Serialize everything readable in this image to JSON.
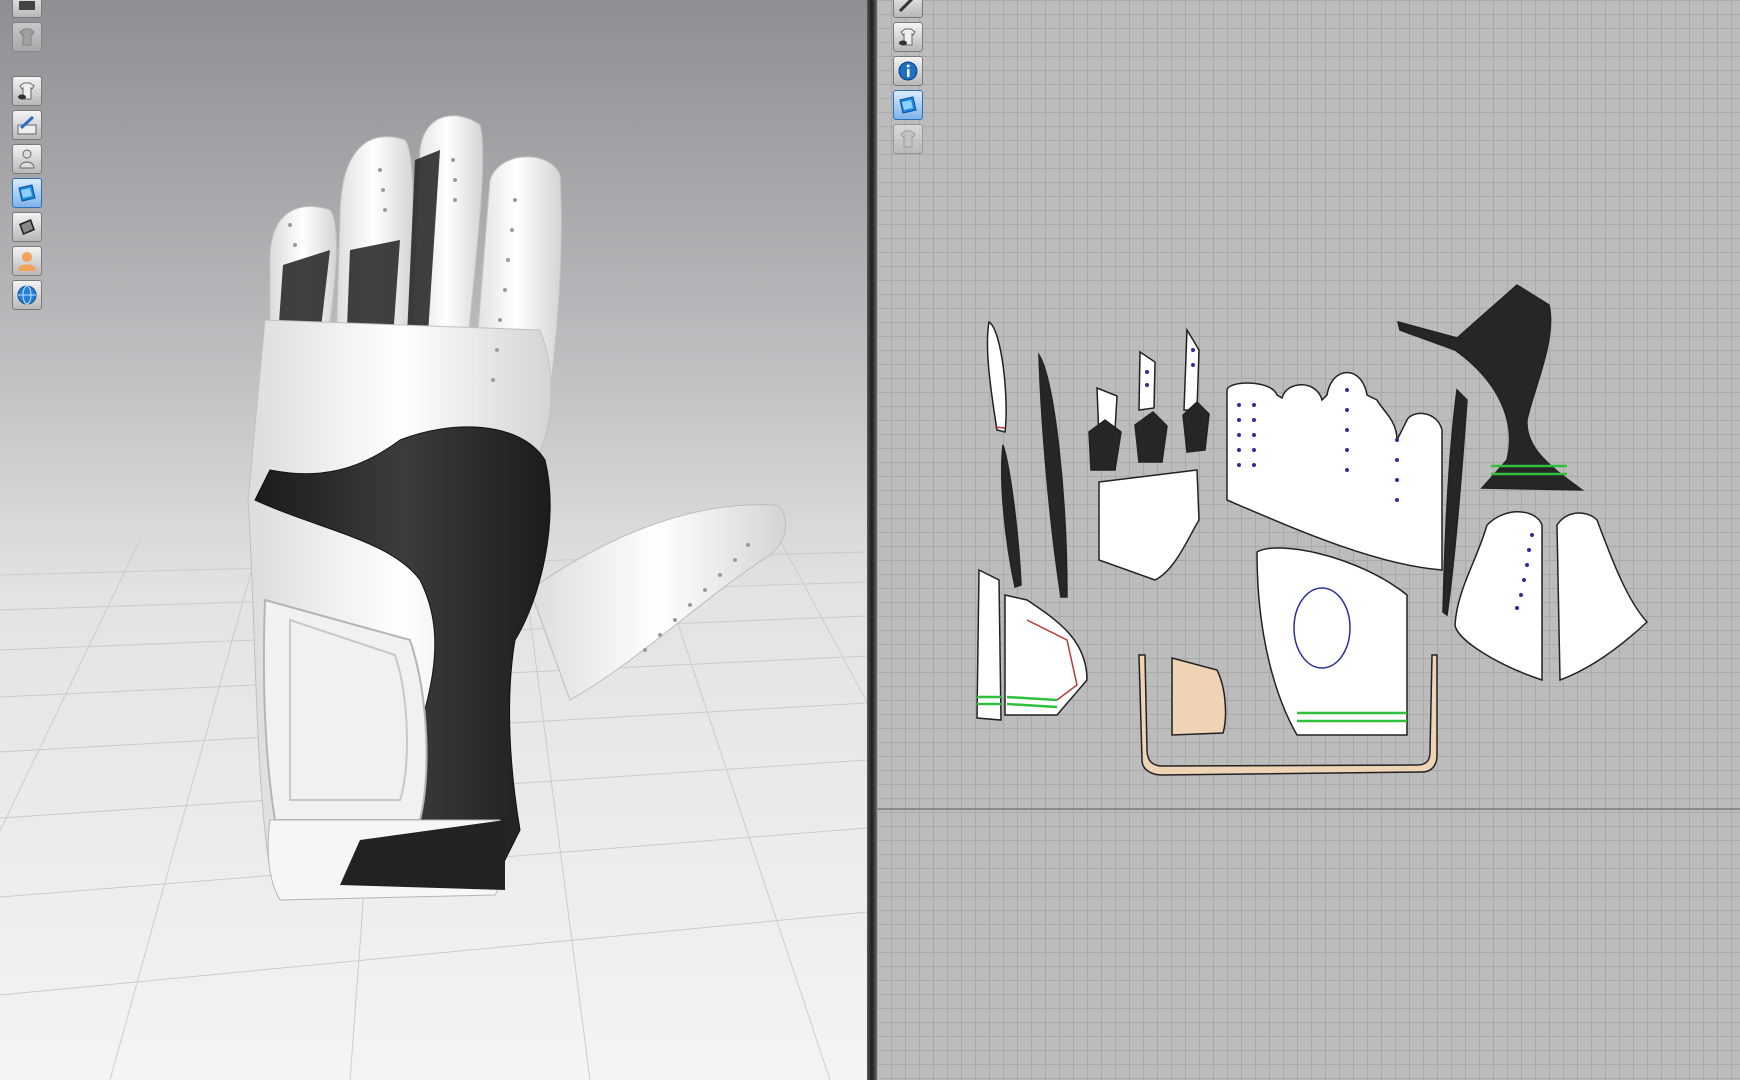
{
  "viewport_3d": {
    "toolbar": [
      {
        "icon": "render-settings-icon",
        "state": "normal"
      },
      {
        "icon": "garment-shirt-icon",
        "state": "disabled"
      },
      {
        "icon": "show-garment-icon",
        "state": "normal"
      },
      {
        "icon": "show-pins-icon",
        "state": "normal"
      },
      {
        "icon": "show-avatar-icon",
        "state": "normal"
      },
      {
        "icon": "texture-view-icon",
        "state": "active"
      },
      {
        "icon": "shading-mode-icon",
        "state": "normal"
      },
      {
        "icon": "avatar-skin-icon",
        "state": "normal"
      },
      {
        "icon": "environment-globe-icon",
        "state": "normal"
      }
    ]
  },
  "viewport_2d": {
    "toolbar": [
      {
        "icon": "edit-pattern-icon",
        "state": "normal"
      },
      {
        "icon": "show-pattern-icon",
        "state": "normal"
      },
      {
        "icon": "info-icon",
        "state": "normal"
      },
      {
        "icon": "texture-2d-icon",
        "state": "active"
      },
      {
        "icon": "lock-pattern-icon",
        "state": "disabled"
      }
    ]
  },
  "colors": {
    "fabric_white": "#ffffff",
    "fabric_black": "#262626",
    "fabric_tan": "#eed3b5",
    "seam_green": "#2fbf3a",
    "seam_red": "#b23a3a",
    "perforation_dots": "#2c2f9a"
  }
}
